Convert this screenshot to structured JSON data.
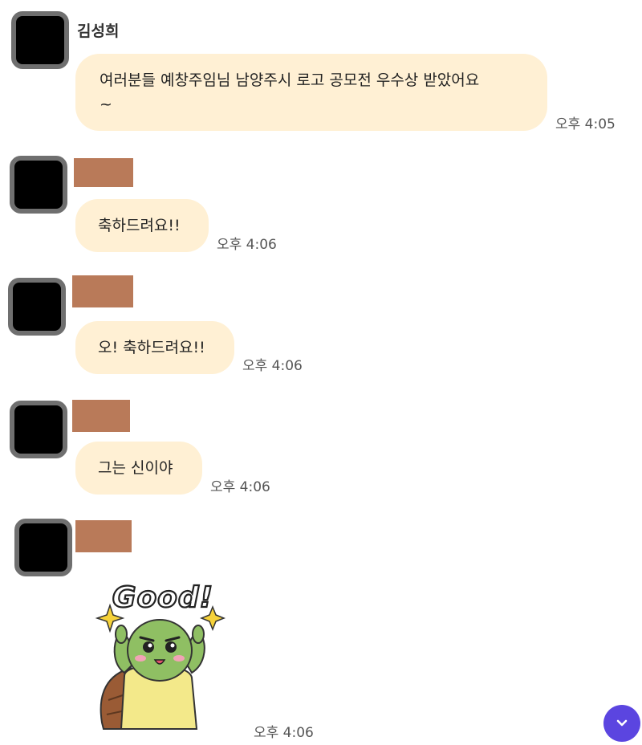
{
  "messages": [
    {
      "sender": "김성희",
      "text_line1": "여러분들 예창주임님 남양주시 로고 공모전 우수상 받았어요",
      "text_line2": "~",
      "time": "오후 4:05"
    },
    {
      "text": "축하드려요!!",
      "time": "오후 4:06"
    },
    {
      "text": "오! 축하드려요!!",
      "time": "오후 4:06"
    },
    {
      "text": "그는 신이야",
      "time": "오후 4:06"
    },
    {
      "sticker": {
        "caption": "Good!",
        "character": "turtle"
      },
      "time": "오후 4:06"
    }
  ],
  "colors": {
    "bubble": "#fff0d4",
    "redaction": "#b97a59",
    "accent": "#5b45e0",
    "avatar_frame": "#6f6f6f"
  },
  "scroll_button": {
    "icon": "chevron-down-icon"
  }
}
